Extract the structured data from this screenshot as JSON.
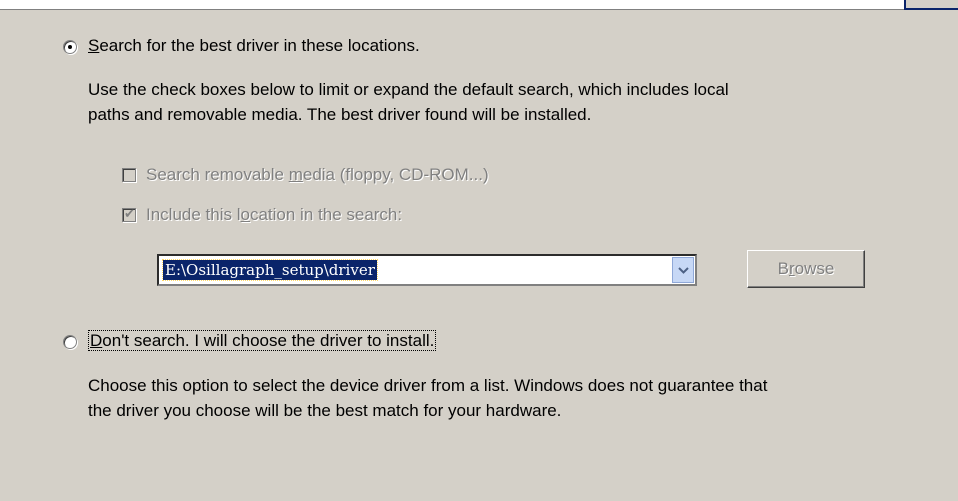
{
  "window": {
    "top_strip": ""
  },
  "option_search": {
    "label_prefix": "",
    "label_mnemonic": "S",
    "label_rest": "earch for the best driver in these locations.",
    "selected": true,
    "description_line1": "Use the check boxes below to limit or expand the default search, which includes local",
    "description_line2": "paths and removable media. The best driver found will be installed."
  },
  "checkbox_removable": {
    "label_prefix": "Search removable ",
    "label_mnemonic": "m",
    "label_rest": "edia (floppy, CD-ROM...)",
    "checked": false,
    "enabled": false
  },
  "checkbox_location": {
    "label_prefix": "Include this l",
    "label_mnemonic": "o",
    "label_rest": "cation in the search:",
    "checked": true,
    "enabled": false
  },
  "location_combo": {
    "value": "E:\\Osillagraph_setup\\driver",
    "arrow_icon": "chevron-down-icon"
  },
  "browse_button": {
    "label_prefix": "B",
    "label_mnemonic": "r",
    "label_rest": "owse",
    "enabled": false
  },
  "option_dont_search": {
    "label_mnemonic": "D",
    "label_rest": "on't search. I will choose the driver to install.",
    "selected": false,
    "description_line1": "Choose this option to select the device driver from a list.  Windows does not guarantee that",
    "description_line2": "the driver you choose will be the best match for your hardware."
  },
  "colors": {
    "dialog_bg": "#d4d0c8",
    "selection_bg": "#0a246a",
    "disabled_text": "#808080"
  }
}
